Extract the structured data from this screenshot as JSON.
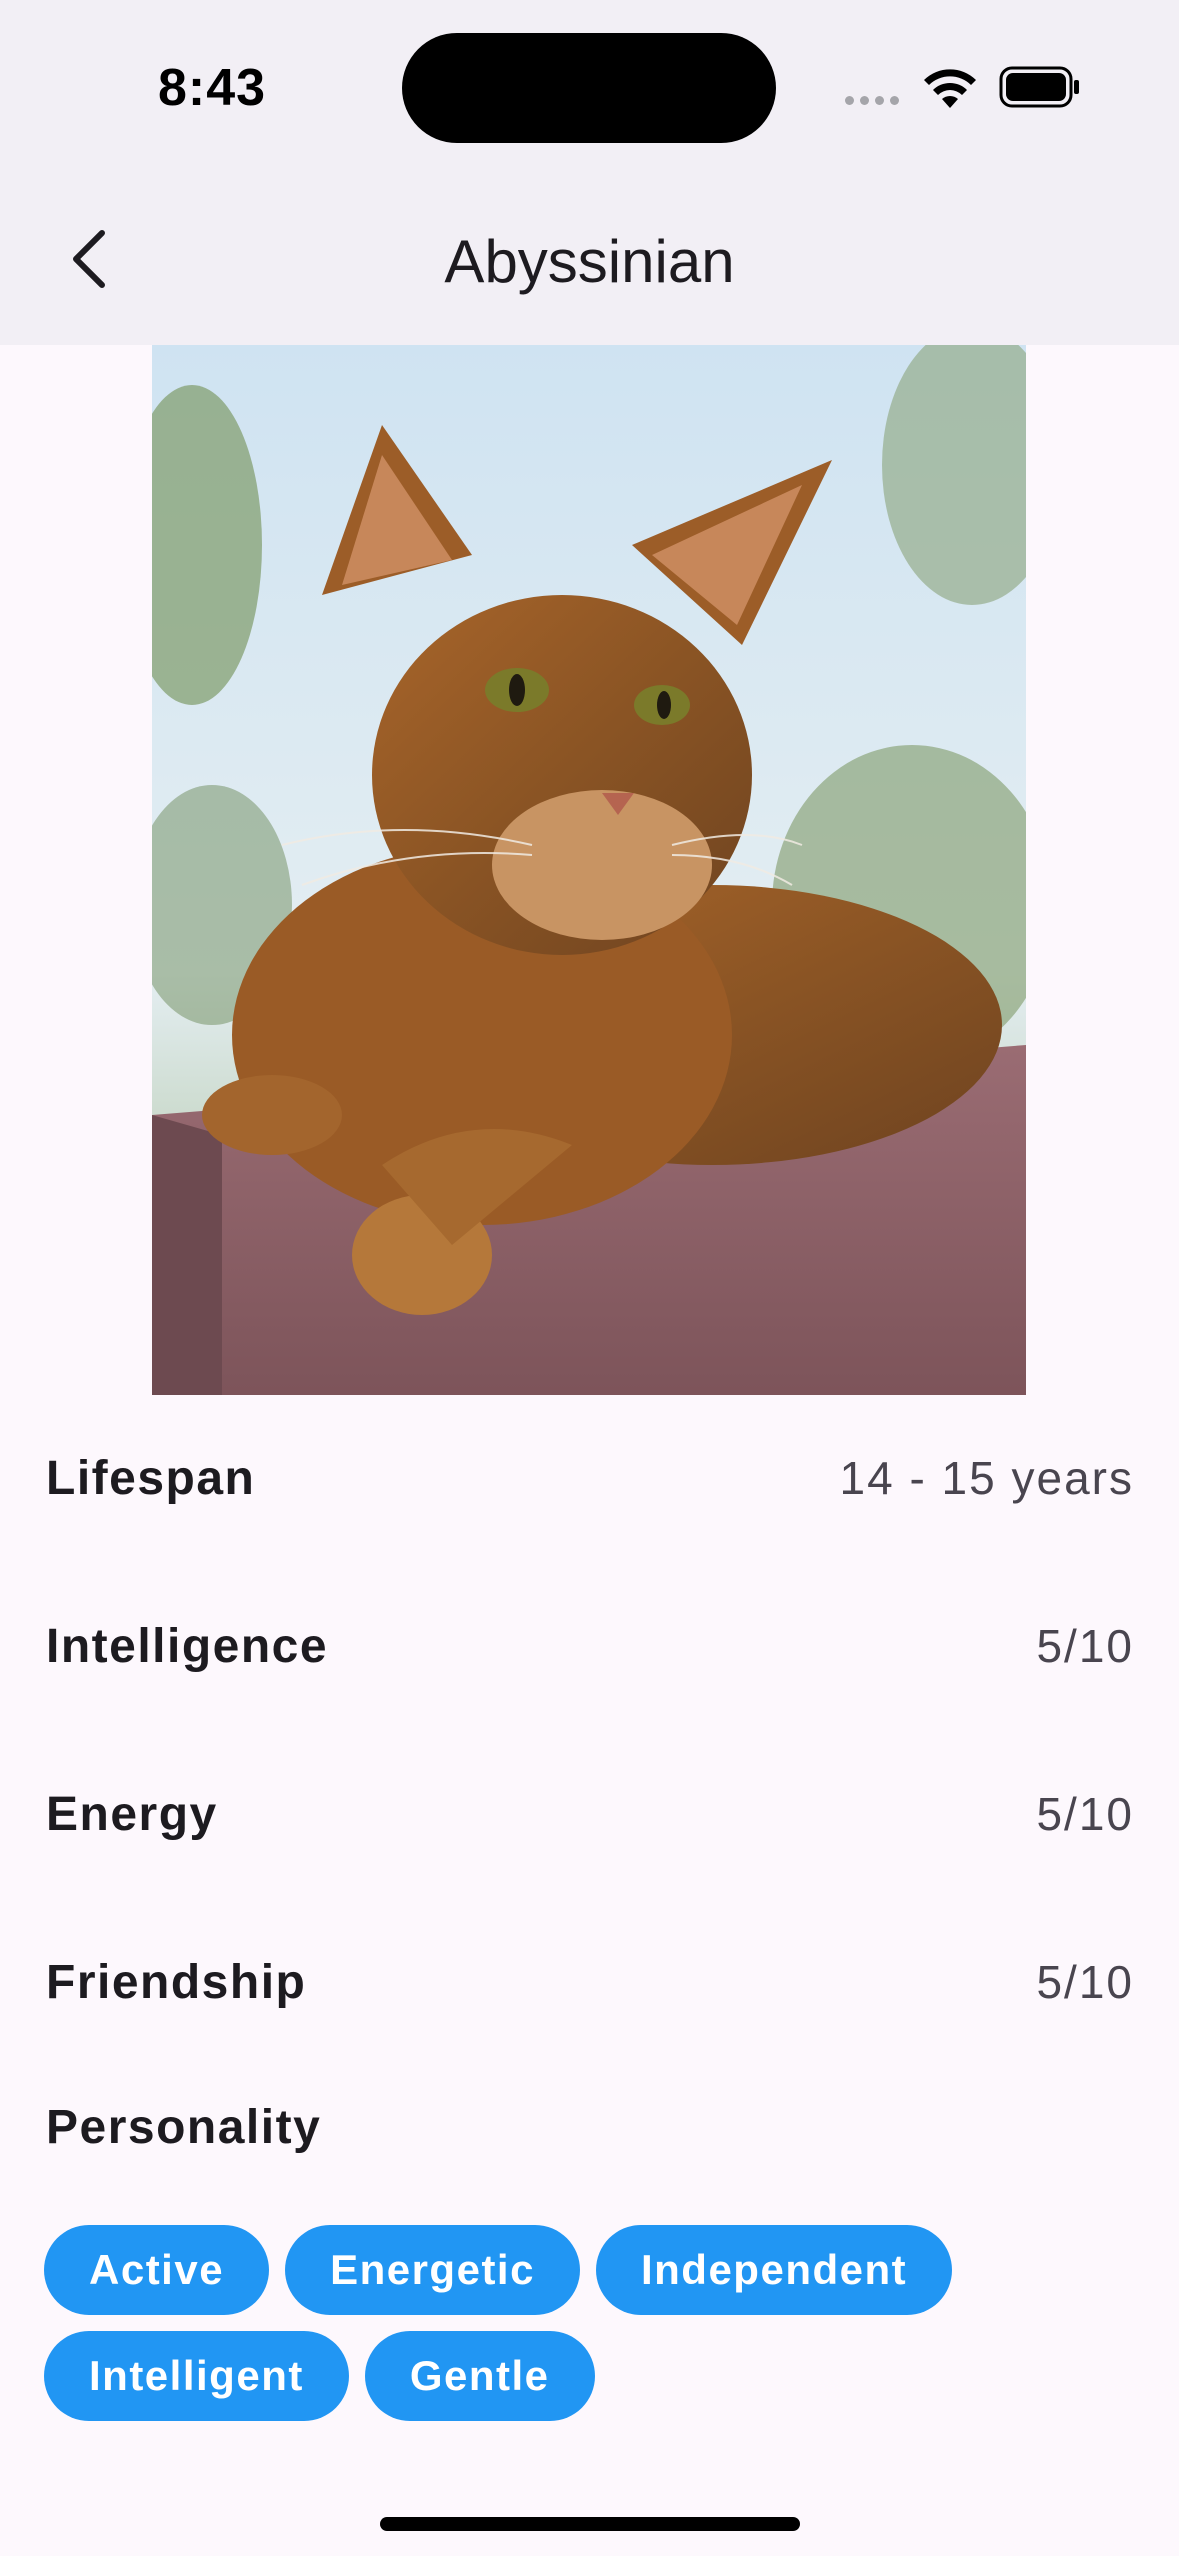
{
  "status_bar": {
    "time": "8:43"
  },
  "app_bar": {
    "title": "Abyssinian"
  },
  "stats": [
    {
      "label": "Lifespan",
      "value": "14 - 15 years"
    },
    {
      "label": "Intelligence",
      "value": "5/10"
    },
    {
      "label": "Energy",
      "value": "5/10"
    },
    {
      "label": "Friendship",
      "value": "5/10"
    }
  ],
  "personality": {
    "title": "Personality",
    "tags": [
      "Active",
      "Energetic",
      "Independent",
      "Intelligent",
      "Gentle"
    ]
  },
  "colors": {
    "chip": "#2196f3",
    "appbar": "#f2eff5",
    "background": "#fdf8fd"
  },
  "icons": {
    "back": "chevron-left-icon",
    "wifi": "wifi-icon",
    "battery": "battery-icon",
    "signal": "cellular-signal-icon"
  }
}
